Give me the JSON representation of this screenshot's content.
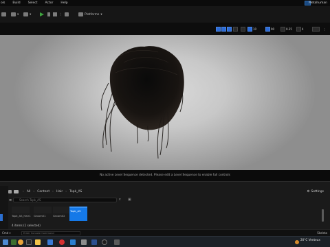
{
  "menu": {
    "items": [
      "ols",
      "Build",
      "Select",
      "Actor",
      "Help"
    ],
    "app_title": "Metahuman"
  },
  "toolbar": {
    "platforms_label": "Platforms"
  },
  "viewport_bar": {
    "fov_value": "90",
    "snap_value": "0.25",
    "scale_value": "10"
  },
  "viewport": {
    "message": "No active Level Sequence detected. Please edit a Level Sequence to enable full controls"
  },
  "content_browser": {
    "breadcrumb": [
      "All",
      "Content",
      "Hair",
      "Topk_AS"
    ],
    "search_placeholder": "Search Topk_AS",
    "settings_label": "Settings",
    "tiles": [
      {
        "label": "Topk_AS_Hair1",
        "color": "#1f1f1f"
      },
      {
        "label": "Groom01",
        "color": "#1f1f1f"
      },
      {
        "label": "Groom02",
        "color": "#1f1f1f"
      }
    ],
    "selected_tile": {
      "label": "Topk_AS"
    },
    "count_text": "4 items (1 selected)"
  },
  "console": {
    "dropdown": "Cmd",
    "placeholder": "Enter Console Command"
  },
  "taskbar": {
    "temperature": "20°C",
    "weather": "Venteux",
    "right_label": "Skeleta"
  },
  "colors": {
    "accent": "#1579e8",
    "play": "#3fa43f",
    "viewport_bg": "#c8c8c8"
  }
}
